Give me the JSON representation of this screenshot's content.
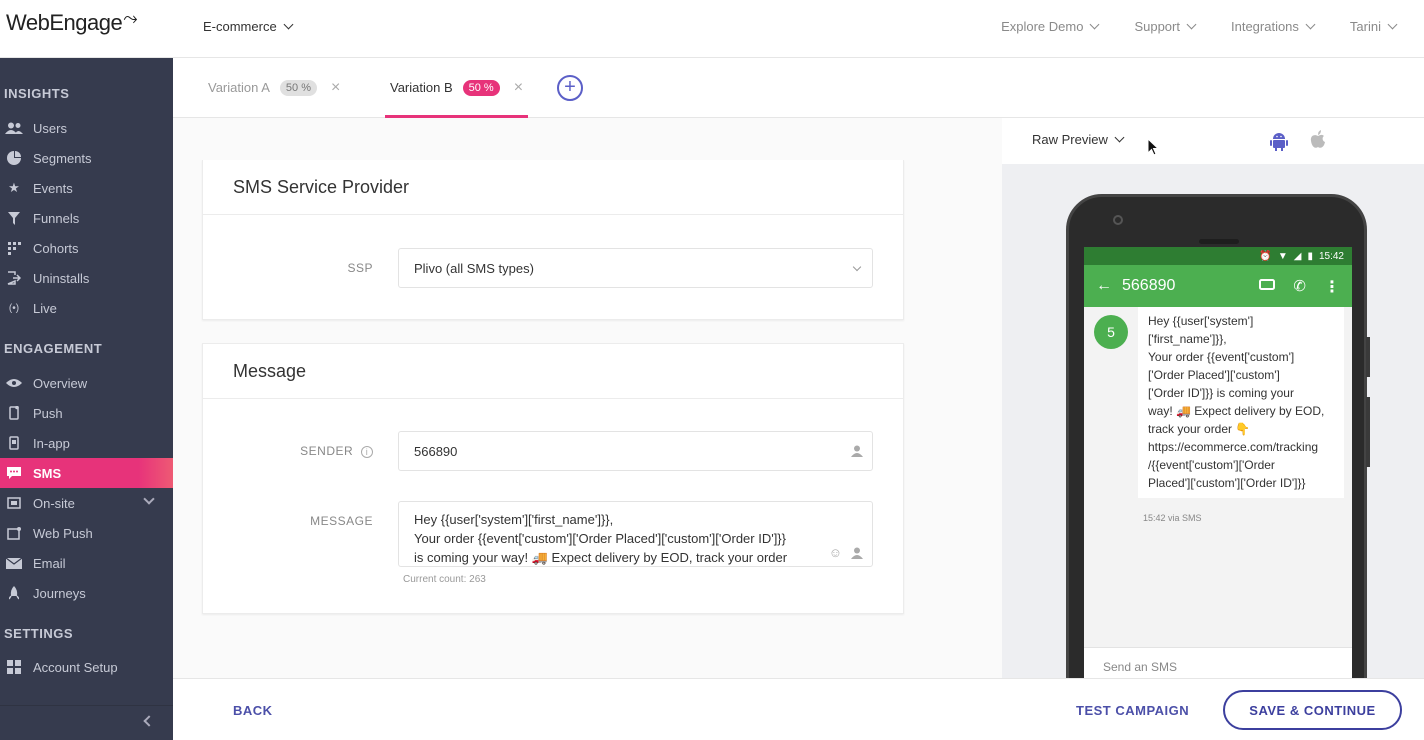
{
  "brand": {
    "logo_text": "WebEngage",
    "accent": "#e7337a",
    "primary": "#3c3f9e",
    "sidebar_bg": "#363b4e"
  },
  "header": {
    "project": "E-commerce",
    "nav": [
      "Explore Demo",
      "Support",
      "Integrations",
      "Tarini"
    ]
  },
  "sidebar": {
    "sections": [
      {
        "title": "INSIGHTS",
        "items": [
          {
            "label": "Users",
            "icon": "users-icon"
          },
          {
            "label": "Segments",
            "icon": "segments-icon"
          },
          {
            "label": "Events",
            "icon": "star-icon"
          },
          {
            "label": "Funnels",
            "icon": "funnel-icon"
          },
          {
            "label": "Cohorts",
            "icon": "grid-icon"
          },
          {
            "label": "Uninstalls",
            "icon": "exit-icon"
          },
          {
            "label": "Live",
            "icon": "broadcast-icon"
          }
        ]
      },
      {
        "title": "ENGAGEMENT",
        "items": [
          {
            "label": "Overview",
            "icon": "eye-icon"
          },
          {
            "label": "Push",
            "icon": "phone-icon"
          },
          {
            "label": "In-app",
            "icon": "tablet-icon"
          },
          {
            "label": "SMS",
            "icon": "chat-icon",
            "active": true
          },
          {
            "label": "On-site",
            "icon": "window-icon"
          },
          {
            "label": "Web Push",
            "icon": "browser-icon"
          },
          {
            "label": "Email",
            "icon": "envelope-icon"
          },
          {
            "label": "Journeys",
            "icon": "rocket-icon"
          }
        ]
      },
      {
        "title": "SETTINGS",
        "items": [
          {
            "label": "Account Setup",
            "icon": "grid-icon"
          }
        ]
      }
    ]
  },
  "tabs": [
    {
      "label": "Variation A",
      "percent": "50 %"
    },
    {
      "label": "Variation B",
      "percent": "50 %",
      "active": true
    }
  ],
  "ssp_card": {
    "title": "SMS Service Provider",
    "ssp_label": "SSP",
    "ssp_value": "Plivo (all SMS types)"
  },
  "message_card": {
    "title": "Message",
    "sender_label": "SENDER",
    "sender_value": "566890",
    "message_label": "MESSAGE",
    "message_lines": [
      "Hey {{user['system']['first_name']}},",
      "Your order {{event['custom']['Order Placed']['custom']['Order ID']}}",
      "is coming your way! 🚚 Expect delivery by EOD, track your order"
    ],
    "counter": "Current count: 263"
  },
  "preview": {
    "mode": "Raw Preview",
    "platforms": [
      "android-icon",
      "apple-icon"
    ],
    "status_time": "15:42",
    "contact": "566890",
    "avatar_letter": "5",
    "sms_lines": [
      "Hey {{user['system']",
      "['first_name']}},",
      "Your order {{event['custom']",
      "['Order Placed']['custom']",
      "['Order ID']}} is coming your",
      "way! 🚚 Expect delivery by EOD,",
      "track your order 👇",
      "https://ecommerce.com/tracking",
      "/{{event['custom']['Order",
      "Placed']['custom']['Order ID']}}"
    ],
    "sms_meta": "15:42 via SMS",
    "send_placeholder": "Send an SMS"
  },
  "footer": {
    "back": "BACK",
    "test": "TEST CAMPAIGN",
    "save": "SAVE & CONTINUE"
  }
}
